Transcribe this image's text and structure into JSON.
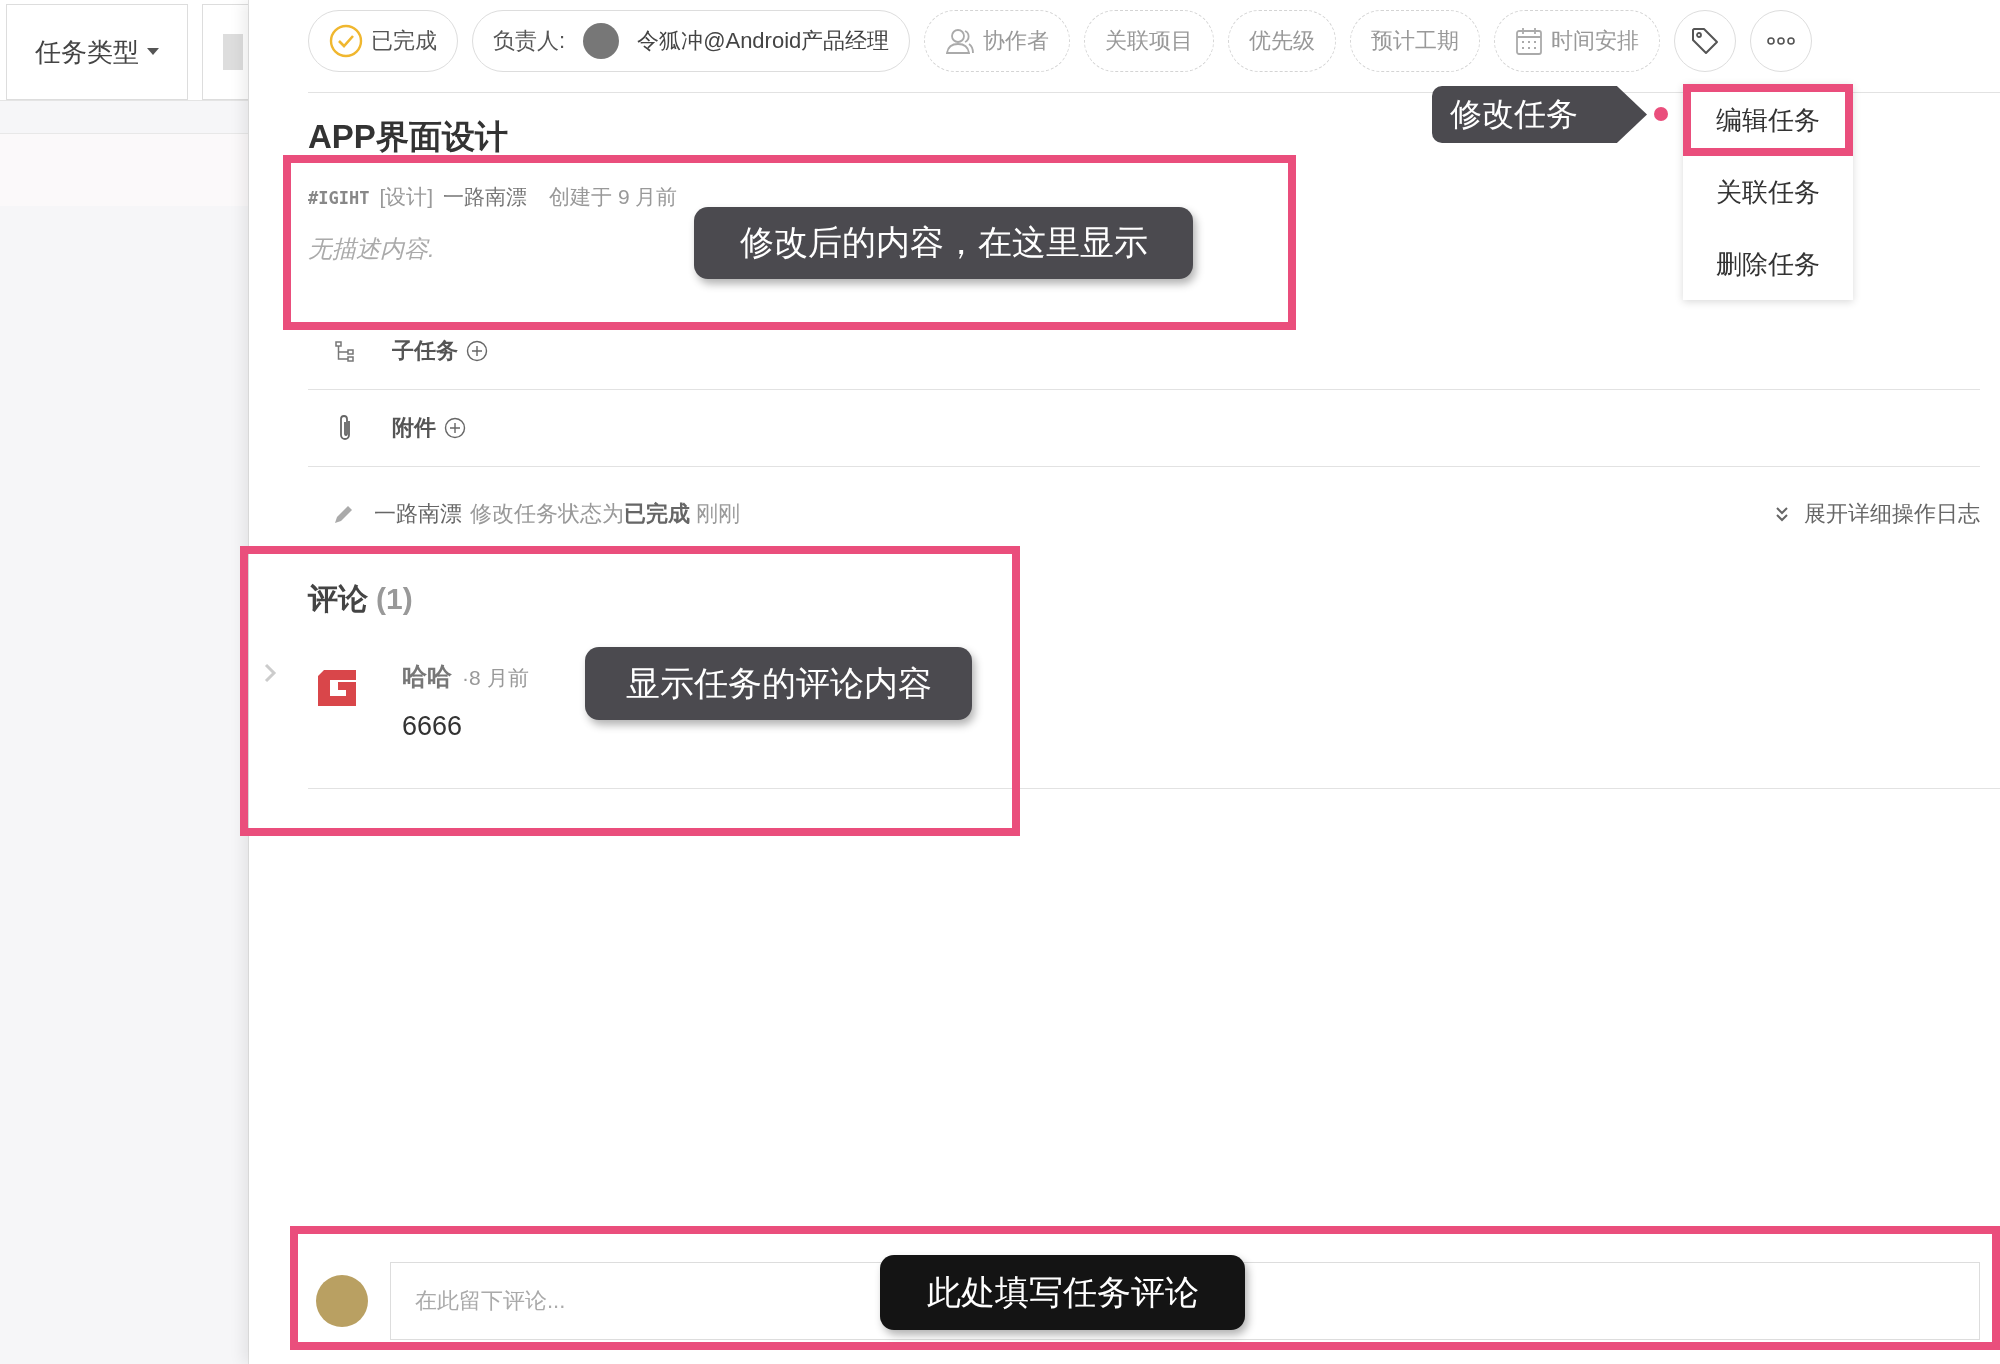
{
  "sidebar": {
    "filter_button": "任务类型"
  },
  "toolbar": {
    "status": {
      "label": "已完成",
      "checked": true
    },
    "assignee": {
      "prefix": "负责人:",
      "name": "令狐冲@Android产品经理"
    },
    "fields": [
      {
        "label": "协作者",
        "kind": "person"
      },
      {
        "label": "关联项目",
        "kind": "plain"
      },
      {
        "label": "优先级",
        "kind": "plain"
      },
      {
        "label": "预计工期",
        "kind": "plain"
      },
      {
        "label": "时间安排",
        "kind": "calendar"
      }
    ]
  },
  "more_menu": {
    "items": [
      {
        "label": "编辑任务",
        "selected": true
      },
      {
        "label": "关联任务",
        "selected": false
      },
      {
        "label": "删除任务",
        "selected": false
      }
    ]
  },
  "task": {
    "title": "APP界面设计",
    "id": "#IGIHT",
    "tag": "[设计]",
    "creator": "一路南漂",
    "created": "创建于 9 月前",
    "description": "无描述内容."
  },
  "sections": [
    {
      "label": "子任务",
      "kind": "subtask"
    },
    {
      "label": "附件",
      "kind": "attachment"
    }
  ],
  "activity": {
    "actor": "一路南漂",
    "message": "修改任务状态为**已完成** 刚刚",
    "expand_log": "展开详细操作日志"
  },
  "comments": {
    "heading": "评论",
    "count": "(1)",
    "items": [
      {
        "author": "哈哈",
        "time": "·8 月前",
        "text": "6666"
      }
    ]
  },
  "comment_input": {
    "placeholder": "在此留下评论..."
  },
  "annotations": {
    "menu": "修改任务",
    "description": "修改后的内容，在这里显示",
    "comments": "显示任务的评论内容",
    "input": "此处填写任务评论"
  }
}
